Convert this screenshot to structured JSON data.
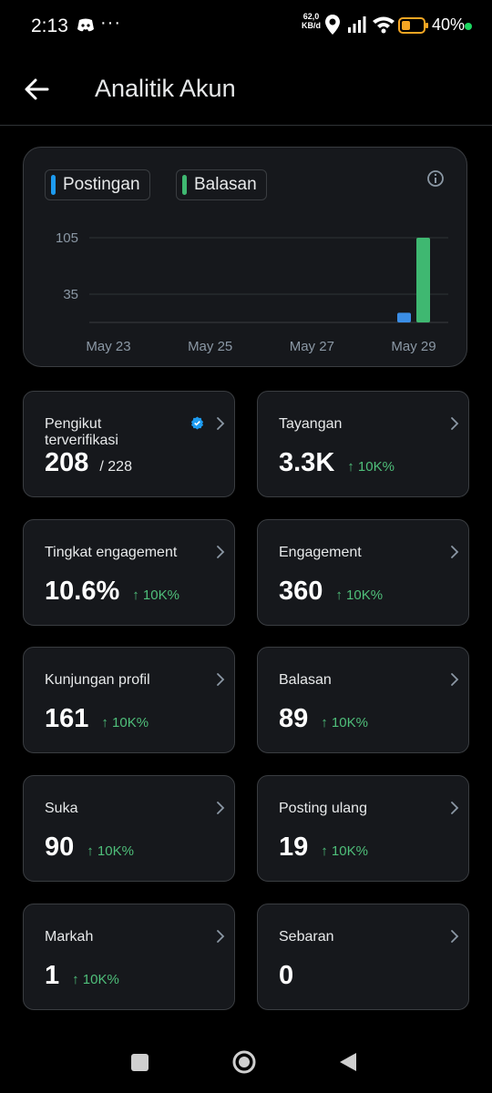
{
  "status_bar": {
    "time": "2:13",
    "more": "···",
    "net_speed": "62,0",
    "net_unit": "KB/d",
    "battery_pct": "40%"
  },
  "header": {
    "title": "Analitik Akun"
  },
  "chart_data": {
    "type": "bar",
    "legend": [
      {
        "name": "Postingan",
        "color": "#1d9bf0"
      },
      {
        "name": "Balasan",
        "color": "#3fb871"
      }
    ],
    "y_ticks": [
      "105",
      "35"
    ],
    "x_ticks": [
      "May 23",
      "May 25",
      "May 27",
      "May 29"
    ],
    "ylim": [
      0,
      105
    ],
    "series": [
      {
        "name": "Postingan",
        "color": "#3b8ee6",
        "points": [
          {
            "x": "May 29",
            "value": 12
          }
        ]
      },
      {
        "name": "Balasan",
        "color": "#3fb871",
        "points": [
          {
            "x": "May 29",
            "value": 105
          }
        ]
      }
    ]
  },
  "stats": [
    {
      "label": "Pengikut terverifikasi",
      "value": "208",
      "total": "/ 228",
      "verified_icon": "verified-badge-icon"
    },
    {
      "label": "Tayangan",
      "value": "3.3K",
      "delta": "↑ 10K%"
    },
    {
      "label": "Tingkat engagement",
      "value": "10.6%",
      "delta": "↑ 10K%"
    },
    {
      "label": "Engagement",
      "value": "360",
      "delta": "↑ 10K%"
    },
    {
      "label": "Kunjungan profil",
      "value": "161",
      "delta": "↑ 10K%"
    },
    {
      "label": "Balasan",
      "value": "89",
      "delta": "↑ 10K%"
    },
    {
      "label": "Suka",
      "value": "90",
      "delta": "↑ 10K%"
    },
    {
      "label": "Posting ulang",
      "value": "19",
      "delta": "↑ 10K%"
    },
    {
      "label": "Markah",
      "value": "1",
      "delta": "↑ 10K%"
    },
    {
      "label": "Sebaran",
      "value": "0"
    }
  ],
  "colors": {
    "background": "#000000",
    "card": "#16181c",
    "border": "#3a3d41",
    "positive": "#4fbf7a",
    "accent": "#1d9bf0"
  }
}
